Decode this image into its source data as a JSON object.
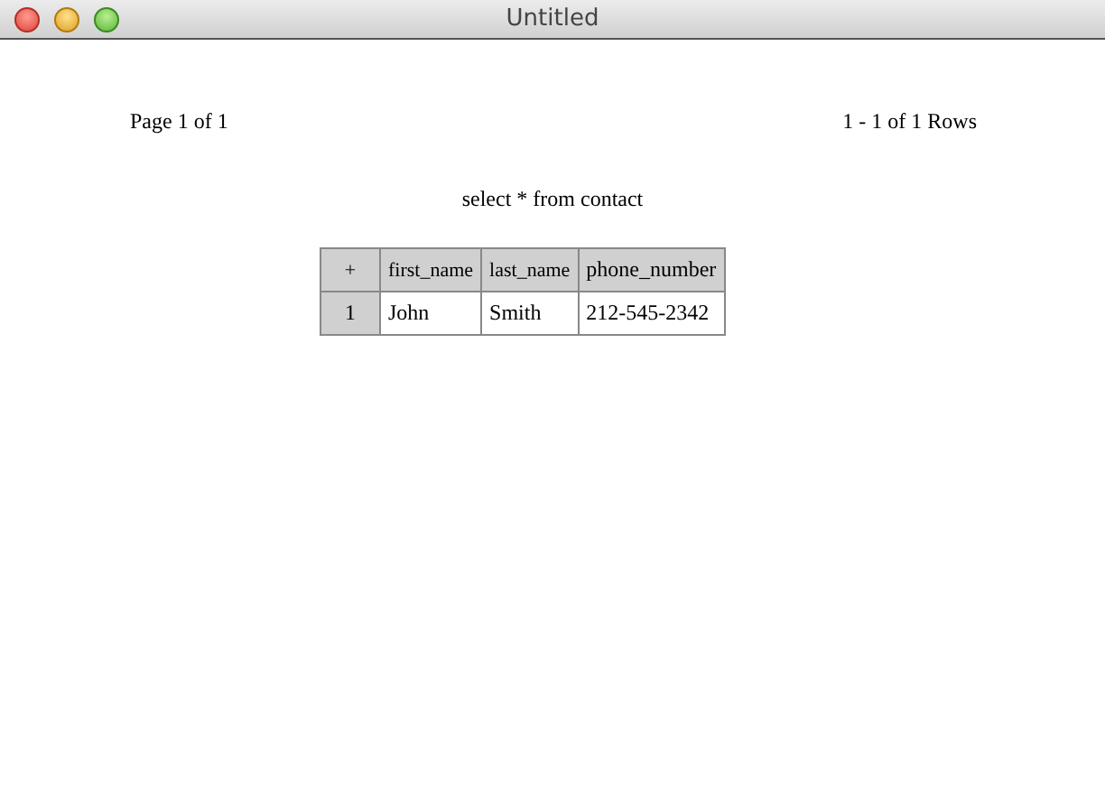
{
  "window": {
    "title": "Untitled"
  },
  "pager": {
    "page": "Page 1 of 1",
    "rows": "1 - 1 of 1 Rows"
  },
  "query": "select * from contact",
  "table": {
    "corner": "+",
    "columns": [
      "first_name",
      "last_name",
      "phone_number"
    ],
    "rows": [
      {
        "number": "1",
        "cells": [
          "John",
          "Smith",
          "212-545-2342"
        ]
      }
    ]
  }
}
